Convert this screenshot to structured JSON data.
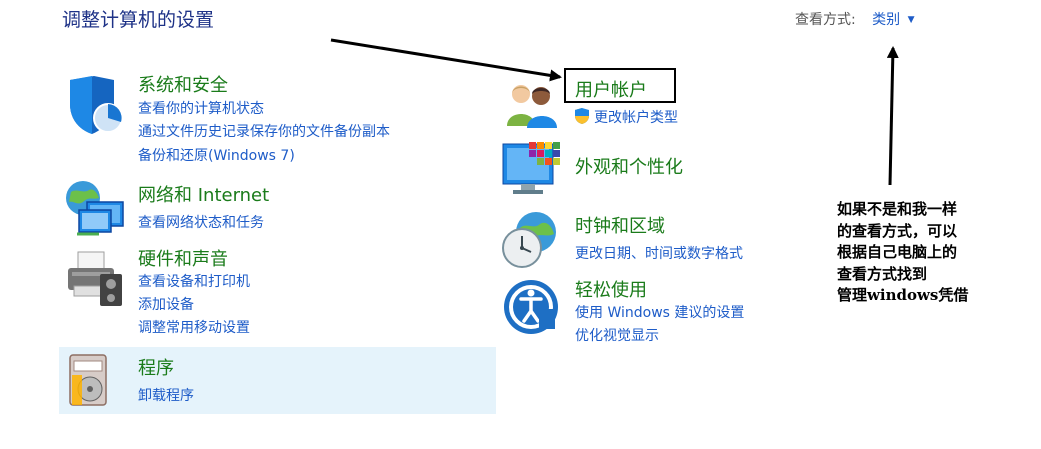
{
  "page_title": "调整计算机的设置",
  "view_by": {
    "label": "查看方式:",
    "value": "类别"
  },
  "categories": {
    "system": {
      "title": "系统和安全",
      "links": [
        "查看你的计算机状态",
        "通过文件历史记录保存你的文件备份副本",
        "备份和还原(Windows 7)"
      ]
    },
    "network": {
      "title": "网络和 Internet",
      "links": [
        "查看网络状态和任务"
      ]
    },
    "hardware": {
      "title": "硬件和声音",
      "links": [
        "查看设备和打印机",
        "添加设备",
        "调整常用移动设置"
      ]
    },
    "programs": {
      "title": "程序",
      "links": [
        "卸载程序"
      ]
    },
    "user_accounts": {
      "title": "用户帐户",
      "links": [
        "更改帐户类型"
      ]
    },
    "appearance": {
      "title": "外观和个性化",
      "links": []
    },
    "clock": {
      "title": "时钟和区域",
      "links": [
        "更改日期、时间或数字格式"
      ]
    },
    "ease": {
      "title": "轻松使用",
      "links": [
        "使用 Windows 建议的设置",
        "优化视觉显示"
      ]
    }
  },
  "annotation_note": [
    "如果不是和我一样",
    "的查看方式，可以",
    "根据自己电脑上的",
    "查看方式找到",
    "管理windows凭借"
  ],
  "colors": {
    "title": "#1e3287",
    "category_title": "#1a7b1a",
    "link": "#1e5cc8",
    "highlight": "#e5f3fb"
  }
}
